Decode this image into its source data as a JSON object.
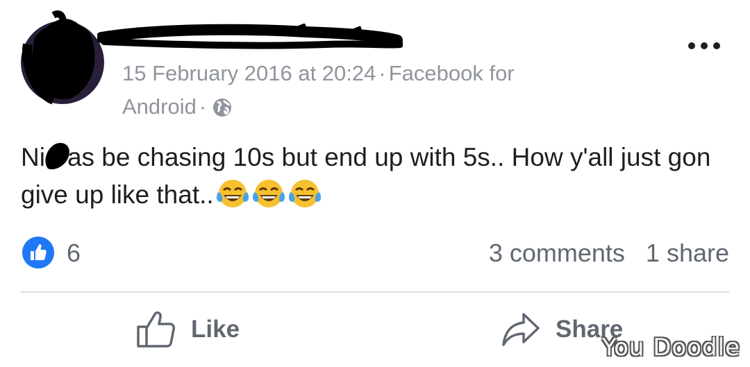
{
  "post": {
    "author_name": "",
    "timestamp": "15 February 2016 at 20:24",
    "source": "Facebook for Android",
    "source_line1": "Facebook for",
    "source_line2": "Android",
    "separator": "·",
    "privacy_icon": "globe-icon",
    "text_prefix": "Ni",
    "text_main": "as be chasing 10s but end up with 5s.. How y'all just gon give up like that..",
    "emoji": [
      "face-with-tears-of-joy",
      "face-with-tears-of-joy",
      "face-with-tears-of-joy"
    ]
  },
  "stats": {
    "likes": "6",
    "comments": "3 comments",
    "shares": "1 share"
  },
  "actions": {
    "like_label": "Like",
    "share_label": "Share"
  },
  "watermark": "You Doodle",
  "colors": {
    "like_blue": "#2078f4",
    "meta_gray": "#90949c",
    "action_gray": "#606770",
    "text_dark": "#1c1e21",
    "divider": "#dadde1"
  }
}
